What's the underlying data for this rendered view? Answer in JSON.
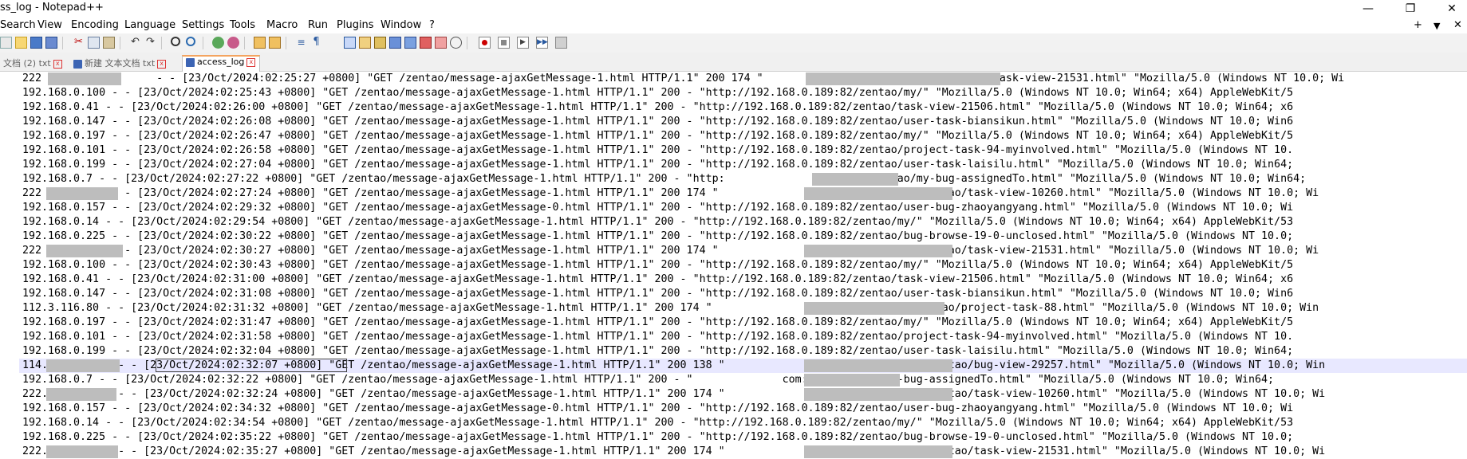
{
  "window": {
    "title": "ss_log - Notepad++",
    "buttons": {
      "minimize": "—",
      "maximize": "❐",
      "close": "✕"
    }
  },
  "menu": {
    "items": [
      "Search",
      "View",
      "Encoding",
      "Language",
      "Settings",
      "Tools",
      "Macro",
      "Run",
      "Plugins",
      "Window",
      "?"
    ],
    "right_controls": [
      "+",
      "▼",
      "✕"
    ]
  },
  "toolbar": {
    "icons": [
      "new-icon",
      "open-icon",
      "save-icon",
      "save-all-icon",
      "close-icon",
      "close-all-icon",
      "print-icon",
      "cut-icon",
      "copy-icon",
      "paste-icon",
      "undo-icon",
      "redo-icon",
      "find-icon",
      "replace-icon",
      "zoom-in-icon",
      "zoom-out-icon",
      "sync-vertical-icon",
      "sync-horizontal-icon",
      "word-wrap-icon",
      "show-all-chars-icon",
      "indent-guide-icon",
      "udl-icon",
      "doc-map-icon",
      "function-list-icon",
      "folder-workspace-icon",
      "monitoring-icon",
      "record-macro-icon",
      "stop-macro-icon",
      "play-macro-icon",
      "run-macro-multiple-icon",
      "save-macro-icon"
    ]
  },
  "tabs": [
    {
      "label": "文档 (2) txt",
      "active": false
    },
    {
      "label": "新建 文本文档 txt",
      "active": false
    },
    {
      "label": "access_log",
      "active": true
    }
  ],
  "editor": {
    "current_line_index": 21,
    "lines": [
      "222                  - - [23/Oct/2024:02:25:27 +0800] \"GET /zentao/message-ajaxGetMessage-1.html HTTP/1.1\" 200 174 \"                            /zentao/task-view-21531.html\" \"Mozilla/5.0 (Windows NT 10.0; Wi",
      "192.168.0.100 - - [23/Oct/2024:02:25:43 +0800] \"GET /zentao/message-ajaxGetMessage-1.html HTTP/1.1\" 200 - \"http://192.168.0.189:82/zentao/my/\" \"Mozilla/5.0 (Windows NT 10.0; Win64; x64) AppleWebKit/5",
      "192.168.0.41 - - [23/Oct/2024:02:26:00 +0800] \"GET /zentao/message-ajaxGetMessage-1.html HTTP/1.1\" 200 - \"http://192.168.0.189:82/zentao/task-view-21506.html\" \"Mozilla/5.0 (Windows NT 10.0; Win64; x6",
      "192.168.0.147 - - [23/Oct/2024:02:26:08 +0800] \"GET /zentao/message-ajaxGetMessage-1.html HTTP/1.1\" 200 - \"http://192.168.0.189:82/zentao/user-task-biansikun.html\" \"Mozilla/5.0 (Windows NT 10.0; Win6",
      "192.168.0.197 - - [23/Oct/2024:02:26:47 +0800] \"GET /zentao/message-ajaxGetMessage-1.html HTTP/1.1\" 200 - \"http://192.168.0.189:82/zentao/my/\" \"Mozilla/5.0 (Windows NT 10.0; Win64; x64) AppleWebKit/5",
      "192.168.0.101 - - [23/Oct/2024:02:26:58 +0800] \"GET /zentao/message-ajaxGetMessage-1.html HTTP/1.1\" 200 - \"http://192.168.0.189:82/zentao/project-task-94-myinvolved.html\" \"Mozilla/5.0 (Windows NT 10.",
      "192.168.0.199 - - [23/Oct/2024:02:27:04 +0800] \"GET /zentao/message-ajaxGetMessage-1.html HTTP/1.1\" 200 - \"http://192.168.0.189:82/zentao/user-task-laisilu.html\" \"Mozilla/5.0 (Windows NT 10.0; Win64;",
      "192.168.0.7 - - [23/Oct/2024:02:27:22 +0800] \"GET /zentao/message-ajaxGetMessage-1.html HTTP/1.1\" 200 - \"http:              com:9002/zentao/my-bug-assignedTo.html\" \"Mozilla/5.0 (Windows NT 10.0; Win64;",
      "222           - - [23/Oct/2024:02:27:24 +0800] \"GET /zentao/message-ajaxGetMessage-1.html HTTP/1.1\" 200 174 \"                        .net:81/zentao/task-view-10260.html\" \"Mozilla/5.0 (Windows NT 10.0; Wi",
      "192.168.0.157 - - [23/Oct/2024:02:29:32 +0800] \"GET /zentao/message-ajaxGetMessage-0.html HTTP/1.1\" 200 - \"http://192.168.0.189:82/zentao/user-bug-zhaoyangyang.html\" \"Mozilla/5.0 (Windows NT 10.0; Wi",
      "192.168.0.14 - - [23/Oct/2024:02:29:54 +0800] \"GET /zentao/message-ajaxGetMessage-1.html HTTP/1.1\" 200 - \"http://192.168.0.189:82/zentao/my/\" \"Mozilla/5.0 (Windows NT 10.0; Win64; x64) AppleWebKit/53",
      "192.168.0.225 - - [23/Oct/2024:02:30:22 +0800] \"GET /zentao/message-ajaxGetMessage-1.html HTTP/1.1\" 200 - \"http://192.168.0.189:82/zentao/bug-browse-19-0-unclosed.html\" \"Mozilla/5.0 (Windows NT 10.0;",
      "222           - - [23/Oct/2024:02:30:27 +0800] \"GET /zentao/message-ajaxGetMessage-1.html HTTP/1.1\" 200 174 \"                        .net:81/zentao/task-view-21531.html\" \"Mozilla/5.0 (Windows NT 10.0; Wi",
      "192.168.0.100 - - [23/Oct/2024:02:30:43 +0800] \"GET /zentao/message-ajaxGetMessage-1.html HTTP/1.1\" 200 - \"http://192.168.0.189:82/zentao/my/\" \"Mozilla/5.0 (Windows NT 10.0; Win64; x64) AppleWebKit/5",
      "192.168.0.41 - - [23/Oct/2024:02:31:00 +0800] \"GET /zentao/message-ajaxGetMessage-1.html HTTP/1.1\" 200 - \"http://192.168.0.189:82/zentao/task-view-21506.html\" \"Mozilla/5.0 (Windows NT 10.0; Win64; x6",
      "192.168.0.147 - - [23/Oct/2024:02:31:08 +0800] \"GET /zentao/message-ajaxGetMessage-1.html HTTP/1.1\" 200 - \"http://192.168.0.189:82/zentao/user-task-biansikun.html\" \"Mozilla/5.0 (Windows NT 10.0; Win6",
      "112.3.116.80 - - [23/Oct/2024:02:31:32 +0800] \"GET /zentao/message-ajaxGetMessage-1.html HTTP/1.1\" 200 174 \"                        .net:81/zentao/project-task-88.html\" \"Mozilla/5.0 (Windows NT 10.0; Win",
      "192.168.0.197 - - [23/Oct/2024:02:31:47 +0800] \"GET /zentao/message-ajaxGetMessage-1.html HTTP/1.1\" 200 - \"http://192.168.0.189:82/zentao/my/\" \"Mozilla/5.0 (Windows NT 10.0; Win64; x64) AppleWebKit/5",
      "192.168.0.101 - - [23/Oct/2024:02:31:58 +0800] \"GET /zentao/message-ajaxGetMessage-1.html HTTP/1.1\" 200 - \"http://192.168.0.189:82/zentao/project-task-94-myinvolved.html\" \"Mozilla/5.0 (Windows NT 10.",
      "192.168.0.199 - - [23/Oct/2024:02:32:04 +0800] \"GET /zentao/message-ajaxGetMessage-1.html HTTP/1.1\" 200 - \"http://192.168.0.189:82/zentao/user-task-laisilu.html\" \"Mozilla/5.0 (Windows NT 10.0; Win64;",
      "114.           - - [23/Oct/2024:02:32:07 +0800] \"GET /zentao/message-ajaxGetMessage-1.html HTTP/1.1\" 200 138 \"                        .net:81/zentao/bug-view-29257.html\" \"Mozilla/5.0 (Windows NT 10.0; Win",
      "192.168.0.7 - - [23/Oct/2024:02:32:22 +0800] \"GET /zentao/message-ajaxGetMessage-1.html HTTP/1.1\" 200 - \"              com:9002/zentao/my-bug-assignedTo.html\" \"Mozilla/5.0 (Windows NT 10.0; Win64;",
      "222.           - - [23/Oct/2024:02:32:24 +0800] \"GET /zentao/message-ajaxGetMessage-1.html HTTP/1.1\" 200 174 \"                        .net:81/zentao/task-view-10260.html\" \"Mozilla/5.0 (Windows NT 10.0; Wi",
      "192.168.0.157 - - [23/Oct/2024:02:34:32 +0800] \"GET /zentao/message-ajaxGetMessage-0.html HTTP/1.1\" 200 - \"http://192.168.0.189:82/zentao/user-bug-zhaoyangyang.html\" \"Mozilla/5.0 (Windows NT 10.0; Wi",
      "192.168.0.14 - - [23/Oct/2024:02:34:54 +0800] \"GET /zentao/message-ajaxGetMessage-1.html HTTP/1.1\" 200 - \"http://192.168.0.189:82/zentao/my/\" \"Mozilla/5.0 (Windows NT 10.0; Win64; x64) AppleWebKit/53",
      "192.168.0.225 - - [23/Oct/2024:02:35:22 +0800] \"GET /zentao/message-ajaxGetMessage-1.html HTTP/1.1\" 200 - \"http://192.168.0.189:82/zentao/bug-browse-19-0-unclosed.html\" \"Mozilla/5.0 (Windows NT 10.0;",
      "222.           - - [23/Oct/2024:02:35:27 +0800] \"GET /zentao/message-ajaxGetMessage-1.html HTTP/1.1\" 200 174 \"                        .net:81/zentao/task-view-21531.html\" \"Mozilla/5.0 (Windows NT 10.0; Wi"
    ]
  },
  "colors": {
    "accent_tab": "#f4a460",
    "current_line": "#e8e8ff",
    "redaction": "#bdbdbd"
  }
}
